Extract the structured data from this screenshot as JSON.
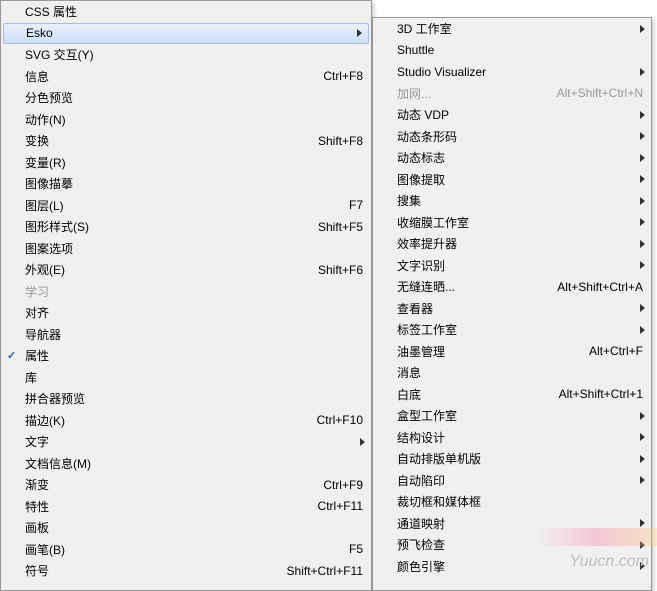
{
  "main_menu": {
    "items": [
      {
        "label": "CSS 属性",
        "shortcut": "",
        "arrow": false,
        "checked": false,
        "highlighted": false,
        "disabled": false
      },
      {
        "label": "Esko",
        "shortcut": "",
        "arrow": true,
        "checked": false,
        "highlighted": true,
        "disabled": false
      },
      {
        "label": "SVG 交互(Y)",
        "shortcut": "",
        "arrow": false,
        "checked": false,
        "highlighted": false,
        "disabled": false
      },
      {
        "label": "信息",
        "shortcut": "Ctrl+F8",
        "arrow": false,
        "checked": false,
        "highlighted": false,
        "disabled": false
      },
      {
        "label": "分色预览",
        "shortcut": "",
        "arrow": false,
        "checked": false,
        "highlighted": false,
        "disabled": false
      },
      {
        "label": "动作(N)",
        "shortcut": "",
        "arrow": false,
        "checked": false,
        "highlighted": false,
        "disabled": false
      },
      {
        "label": "变换",
        "shortcut": "Shift+F8",
        "arrow": false,
        "checked": false,
        "highlighted": false,
        "disabled": false
      },
      {
        "label": "变量(R)",
        "shortcut": "",
        "arrow": false,
        "checked": false,
        "highlighted": false,
        "disabled": false
      },
      {
        "label": "图像描摹",
        "shortcut": "",
        "arrow": false,
        "checked": false,
        "highlighted": false,
        "disabled": false
      },
      {
        "label": "图层(L)",
        "shortcut": "F7",
        "arrow": false,
        "checked": false,
        "highlighted": false,
        "disabled": false
      },
      {
        "label": "图形样式(S)",
        "shortcut": "Shift+F5",
        "arrow": false,
        "checked": false,
        "highlighted": false,
        "disabled": false
      },
      {
        "label": "图案选项",
        "shortcut": "",
        "arrow": false,
        "checked": false,
        "highlighted": false,
        "disabled": false
      },
      {
        "label": "外观(E)",
        "shortcut": "Shift+F6",
        "arrow": false,
        "checked": false,
        "highlighted": false,
        "disabled": false
      },
      {
        "label": "学习",
        "shortcut": "",
        "arrow": false,
        "checked": false,
        "highlighted": false,
        "disabled": true
      },
      {
        "label": "对齐",
        "shortcut": "",
        "arrow": false,
        "checked": false,
        "highlighted": false,
        "disabled": false
      },
      {
        "label": "导航器",
        "shortcut": "",
        "arrow": false,
        "checked": false,
        "highlighted": false,
        "disabled": false
      },
      {
        "label": "属性",
        "shortcut": "",
        "arrow": false,
        "checked": true,
        "highlighted": false,
        "disabled": false
      },
      {
        "label": "库",
        "shortcut": "",
        "arrow": false,
        "checked": false,
        "highlighted": false,
        "disabled": false
      },
      {
        "label": "拼合器预览",
        "shortcut": "",
        "arrow": false,
        "checked": false,
        "highlighted": false,
        "disabled": false
      },
      {
        "label": "描边(K)",
        "shortcut": "Ctrl+F10",
        "arrow": false,
        "checked": false,
        "highlighted": false,
        "disabled": false
      },
      {
        "label": "文字",
        "shortcut": "",
        "arrow": true,
        "checked": false,
        "highlighted": false,
        "disabled": false
      },
      {
        "label": "文档信息(M)",
        "shortcut": "",
        "arrow": false,
        "checked": false,
        "highlighted": false,
        "disabled": false
      },
      {
        "label": "渐变",
        "shortcut": "Ctrl+F9",
        "arrow": false,
        "checked": false,
        "highlighted": false,
        "disabled": false
      },
      {
        "label": "特性",
        "shortcut": "Ctrl+F11",
        "arrow": false,
        "checked": false,
        "highlighted": false,
        "disabled": false
      },
      {
        "label": "画板",
        "shortcut": "",
        "arrow": false,
        "checked": false,
        "highlighted": false,
        "disabled": false
      },
      {
        "label": "画笔(B)",
        "shortcut": "F5",
        "arrow": false,
        "checked": false,
        "highlighted": false,
        "disabled": false
      },
      {
        "label": "符号",
        "shortcut": "Shift+Ctrl+F11",
        "arrow": false,
        "checked": false,
        "highlighted": false,
        "disabled": false
      }
    ]
  },
  "sub_menu": {
    "items": [
      {
        "label": "3D 工作室",
        "shortcut": "",
        "arrow": true,
        "disabled": false
      },
      {
        "label": "Shuttle",
        "shortcut": "",
        "arrow": false,
        "disabled": false
      },
      {
        "label": "Studio Visualizer",
        "shortcut": "",
        "arrow": true,
        "disabled": false
      },
      {
        "label": "加网...",
        "shortcut": "Alt+Shift+Ctrl+N",
        "arrow": false,
        "disabled": true
      },
      {
        "label": "动态 VDP",
        "shortcut": "",
        "arrow": true,
        "disabled": false
      },
      {
        "label": "动态条形码",
        "shortcut": "",
        "arrow": true,
        "disabled": false
      },
      {
        "label": "动态标志",
        "shortcut": "",
        "arrow": true,
        "disabled": false
      },
      {
        "label": "图像提取",
        "shortcut": "",
        "arrow": true,
        "disabled": false
      },
      {
        "label": "搜集",
        "shortcut": "",
        "arrow": true,
        "disabled": false
      },
      {
        "label": "收缩膜工作室",
        "shortcut": "",
        "arrow": true,
        "disabled": false
      },
      {
        "label": "效率提升器",
        "shortcut": "",
        "arrow": true,
        "disabled": false
      },
      {
        "label": "文字识别",
        "shortcut": "",
        "arrow": true,
        "disabled": false
      },
      {
        "label": "无缝连晒...",
        "shortcut": "Alt+Shift+Ctrl+A",
        "arrow": false,
        "disabled": false
      },
      {
        "label": "查看器",
        "shortcut": "",
        "arrow": true,
        "disabled": false
      },
      {
        "label": "标签工作室",
        "shortcut": "",
        "arrow": true,
        "disabled": false
      },
      {
        "label": "油墨管理",
        "shortcut": "Alt+Ctrl+F",
        "arrow": false,
        "disabled": false
      },
      {
        "label": "消息",
        "shortcut": "",
        "arrow": false,
        "disabled": false
      },
      {
        "label": "白底",
        "shortcut": "Alt+Shift+Ctrl+1",
        "arrow": false,
        "disabled": false
      },
      {
        "label": "盒型工作室",
        "shortcut": "",
        "arrow": true,
        "disabled": false
      },
      {
        "label": "结构设计",
        "shortcut": "",
        "arrow": true,
        "disabled": false
      },
      {
        "label": "自动排版单机版",
        "shortcut": "",
        "arrow": true,
        "disabled": false
      },
      {
        "label": "自动陷印",
        "shortcut": "",
        "arrow": true,
        "disabled": false
      },
      {
        "label": "裁切框和媒体框",
        "shortcut": "",
        "arrow": false,
        "disabled": false
      },
      {
        "label": "通道映射",
        "shortcut": "",
        "arrow": true,
        "disabled": false
      },
      {
        "label": "预飞检查",
        "shortcut": "",
        "arrow": true,
        "disabled": false
      },
      {
        "label": "颜色引擎",
        "shortcut": "",
        "arrow": true,
        "disabled": false
      }
    ]
  },
  "watermark": "Yuucn.com"
}
